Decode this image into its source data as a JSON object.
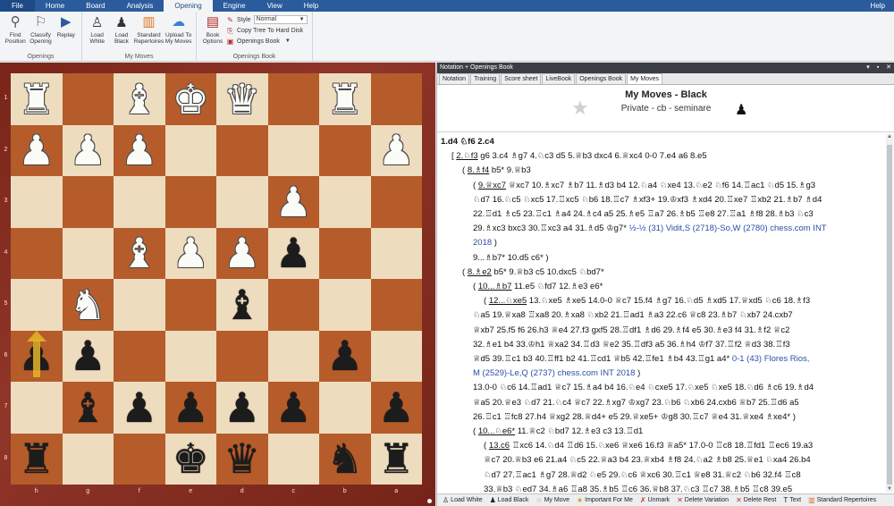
{
  "ribbon_tabs": [
    "File",
    "Home",
    "Board",
    "Analysis",
    "Opening",
    "Engine",
    "View",
    "Help"
  ],
  "help_right": "Help",
  "groups": {
    "openings": {
      "label": "Openings",
      "buttons": [
        {
          "label": "Find Position",
          "icon": "find-position-icon"
        },
        {
          "label": "Classify Opening",
          "icon": "classify-opening-icon"
        },
        {
          "label": "Replay",
          "icon": "replay-icon"
        }
      ]
    },
    "my_moves": {
      "label": "My Moves",
      "buttons": [
        {
          "label": "Load White",
          "icon": "white-pawn-icon"
        },
        {
          "label": "Load Black",
          "icon": "black-pawn-icon"
        },
        {
          "label": "Standard Repertoires",
          "icon": "standard-repertoires-icon"
        },
        {
          "label": "Upload To My Moves",
          "icon": "upload-cloud-icon"
        }
      ]
    },
    "openings_book": {
      "label": "Openings Book",
      "book_options": "Book Options",
      "style_label": "Style",
      "style_value": "Normal",
      "copy_tree": "Copy Tree To Hard Disk",
      "openings_book": "Openings Book"
    }
  },
  "board": {
    "rank_labels": [
      "1",
      "2",
      "3",
      "4",
      "5",
      "6",
      "7",
      "8"
    ],
    "file_labels": [
      "h",
      "g",
      "f",
      "e",
      "d",
      "c",
      "b",
      "a"
    ],
    "rows": [
      [
        "wR",
        "",
        "wB",
        "wK",
        "wQ",
        "",
        "wR",
        ""
      ],
      [
        "wP",
        "wP",
        "wP",
        "",
        "",
        "",
        "",
        "wP"
      ],
      [
        "",
        "",
        "",
        "",
        "",
        "wP",
        "",
        ""
      ],
      [
        "",
        "",
        "wB",
        "wP",
        "wP",
        "bP",
        "",
        ""
      ],
      [
        "",
        "wN",
        "",
        "",
        "bB",
        "",
        "",
        ""
      ],
      [
        "bP",
        "bP",
        "",
        "",
        "",
        "",
        "bP",
        ""
      ],
      [
        "",
        "bB",
        "bP",
        "bP",
        "bP",
        "bP",
        "",
        "bP"
      ],
      [
        "bR",
        "",
        "",
        "bK",
        "bQ",
        "",
        "bN",
        "bR"
      ]
    ],
    "arrow_square": [
      5,
      0
    ]
  },
  "panel": {
    "title": "Notation + Openings Book",
    "tabs": [
      "Notation",
      "Training",
      "Score sheet",
      "LiveBook",
      "Openings Book",
      "My Moves"
    ],
    "active_tab": "My Moves",
    "heading": "My Moves - Black",
    "subheading": "Private - cb - seminare"
  },
  "notation_lines": [
    {
      "indent": 0,
      "main": true,
      "parts": [
        {
          "t": "1.d4  ♘f6  2.c4"
        }
      ]
    },
    {
      "indent": 12,
      "parts": [
        {
          "t": "[ "
        },
        {
          "t": "2.♘f3",
          "cur": true
        },
        {
          "t": "  g6  3.c4  ♗g7  4.♘c3  d5  5.♕b3  dxc4  6.♕xc4  0-0  7.e4  a6  8.e5"
        }
      ]
    },
    {
      "indent": 24,
      "parts": [
        {
          "t": "( "
        },
        {
          "t": "8.♗f4",
          "cur": true
        },
        {
          "t": "  b5*  9.♕b3"
        }
      ]
    },
    {
      "indent": 36,
      "parts": [
        {
          "t": "( "
        },
        {
          "t": "9.♕xc7",
          "cur": true
        },
        {
          "t": "  ♕xc7  10.♗xc7  ♗b7  11.♗d3  b4  12.♘a4  ♘xe4  13.♘e2  ♘f6  14.♖ac1  ♘d5  15.♗g3"
        }
      ]
    },
    {
      "indent": 36,
      "parts": [
        {
          "t": "♘d7  16.♘c5  ♘xc5  17.♖xc5  ♘b6  18.♖c7  ♗xf3+  19.♔xf3  ♗xd4  20.♖xe7  ♖xb2  21.♗b7  ♗d4"
        }
      ]
    },
    {
      "indent": 36,
      "parts": [
        {
          "t": "22.♖d1  ♗c5  23.♖c1  ♗a4  24.♗c4  a5  25.♗e5  ♖a7  26.♗b5  ♖e8  27.♖a1  ♗f8  28.♗b3  ♘c3"
        }
      ]
    },
    {
      "indent": 36,
      "parts": [
        {
          "t": "29.♗xc3  bxc3  30.♖xc3  a4  31.♗d5  ♔g7*  "
        },
        {
          "t": "½-½ (31) Vidit,S (2718)-So,W (2780) chess.com INT",
          "blue": true
        }
      ]
    },
    {
      "indent": 36,
      "parts": [
        {
          "t": "2018",
          "blue": true
        },
        {
          "t": " )"
        }
      ]
    },
    {
      "indent": 36,
      "parts": [
        {
          "t": "9...♗b7*  10.d5  c6* )"
        }
      ]
    },
    {
      "indent": 24,
      "parts": [
        {
          "t": "( "
        },
        {
          "t": "8.♗e2",
          "cur": true
        },
        {
          "t": "  b5*  9.♕b3  c5  10.dxc5  ♘bd7*"
        }
      ]
    },
    {
      "indent": 36,
      "parts": [
        {
          "t": "( "
        },
        {
          "t": "10...♗b7",
          "cur": true
        },
        {
          "t": "  11.e5  ♘fd7  12.♗e3  e6*"
        }
      ]
    },
    {
      "indent": 48,
      "parts": [
        {
          "t": "( "
        },
        {
          "t": "12...♘xe5",
          "cur": true
        },
        {
          "t": "  13.♘xe5  ♗xe5  14.0-0  ♕c7  15.f4  ♗g7  16.♘d5  ♗xd5  17.♕xd5  ♘c6  18.♗f3"
        }
      ]
    },
    {
      "indent": 36,
      "parts": [
        {
          "t": "♘a5  19.♕xa8  ♖xa8  20.♗xa8  ♘xb2  21.♖ad1  ♗a3  22.c6  ♕c8  23.♗b7  ♘xb7  24.cxb7"
        }
      ]
    },
    {
      "indent": 36,
      "parts": [
        {
          "t": "♕xb7  25.f5  f6  26.h3  ♕e4  27.f3  gxf5  28.♖df1  ♗d6  29.♗f4  e5  30.♗e3  f4  31.♗f2  ♕c2"
        }
      ]
    },
    {
      "indent": 36,
      "parts": [
        {
          "t": "32.♗e1  b4  33.♔h1  ♕xa2  34.♖d3  ♕e2  35.♖df3  a5  36.♗h4  ♔f7  37.♖f2  ♕d3  38.♖f3"
        }
      ]
    },
    {
      "indent": 36,
      "parts": [
        {
          "t": "♕d5  39.♖c1  b3  40.♖ff1  b2  41.♖cd1  ♕b5  42.♖fe1  ♗b4  43.♖g1  a4*  "
        },
        {
          "t": "0-1 (43) Flores Rios,",
          "blue": true
        }
      ]
    },
    {
      "indent": 36,
      "parts": [
        {
          "t": "M (2529)-Le,Q (2737) chess.com INT 2018",
          "blue": true
        },
        {
          "t": " )"
        }
      ]
    },
    {
      "indent": 36,
      "parts": [
        {
          "t": "13.0-0  ♘c6  14.♖ad1  ♕c7  15.♗a4  b4  16.♘e4  ♘cxe5  17.♘xe5  ♘xe5  18.♘d6  ♗c6  19.♗d4"
        }
      ]
    },
    {
      "indent": 36,
      "parts": [
        {
          "t": "♕a5  20.♕e3  ♘d7  21.♘c4  ♕c7  22.♗xg7  ♔xg7  23.♘b6  ♘xb6  24.cxb6  ♕b7  25.♖d6  a5"
        }
      ]
    },
    {
      "indent": 36,
      "parts": [
        {
          "t": "26.♖c1  ♖fc8  27.h4  ♕xg2  28.♕d4+  e5  29.♕xe5+  ♔g8  30.♖c7  ♕e4  31.♕xe4  ♗xe4* )"
        }
      ]
    },
    {
      "indent": 36,
      "parts": [
        {
          "t": "( "
        },
        {
          "t": "10...♘e6*",
          "cur": true
        },
        {
          "t": "  11.♕c2  ♘bd7  12.♗e3  c3  13.♖d1"
        }
      ]
    },
    {
      "indent": 48,
      "parts": [
        {
          "t": "( "
        },
        {
          "t": "13.c6",
          "cur": true
        },
        {
          "t": "  ♖xc6  14.♘d4  ♖d6  15.♘xe6  ♕xe6  16.f3  ♕a5*  17.0-0  ♖c8  18.♖fd1  ♖ec6  19.a3"
        }
      ]
    },
    {
      "indent": 48,
      "parts": [
        {
          "t": "♕c7  20.♕b3  e6  21.a4  ♘c5  22.♕a3  b4  23.♕xb4  ♗f8  24.♘a2  ♗b8  25.♕e1  ♘xa4  26.b4"
        }
      ]
    },
    {
      "indent": 48,
      "parts": [
        {
          "t": "♘d7  27.♖ac1  ♗g7  28.♕d2  ♘e5  29.♘c6  ♕xc6  30.♖c1  ♕e8  31.♕c2  ♘b6  32.f4  ♖c8"
        }
      ]
    },
    {
      "indent": 48,
      "parts": [
        {
          "t": "33.♕b3  ♘ed7  34.♗a6  ♖a8  35.♗b5  ♖c6  36.♕b8  37.♘c3  ♖c7  38.♗b5  ♖c8  39.e5"
        }
      ]
    }
  ],
  "status_buttons": [
    {
      "label": "Load White",
      "icon": "white-pawn-icon"
    },
    {
      "label": "Load Black",
      "icon": "black-pawn-icon"
    },
    {
      "label": "My Move",
      "icon": "star-icon"
    },
    {
      "label": "Important For Me",
      "icon": "important-star-icon"
    },
    {
      "label": "Unmark",
      "icon": "unmark-icon"
    },
    {
      "label": "Delete Variation",
      "icon": "delete-variation-icon"
    },
    {
      "label": "Delete Rest",
      "icon": "delete-rest-icon"
    },
    {
      "label": "Text",
      "icon": "text-icon"
    },
    {
      "label": "Standard Repertoires",
      "icon": "standard-repertoires-icon"
    }
  ]
}
